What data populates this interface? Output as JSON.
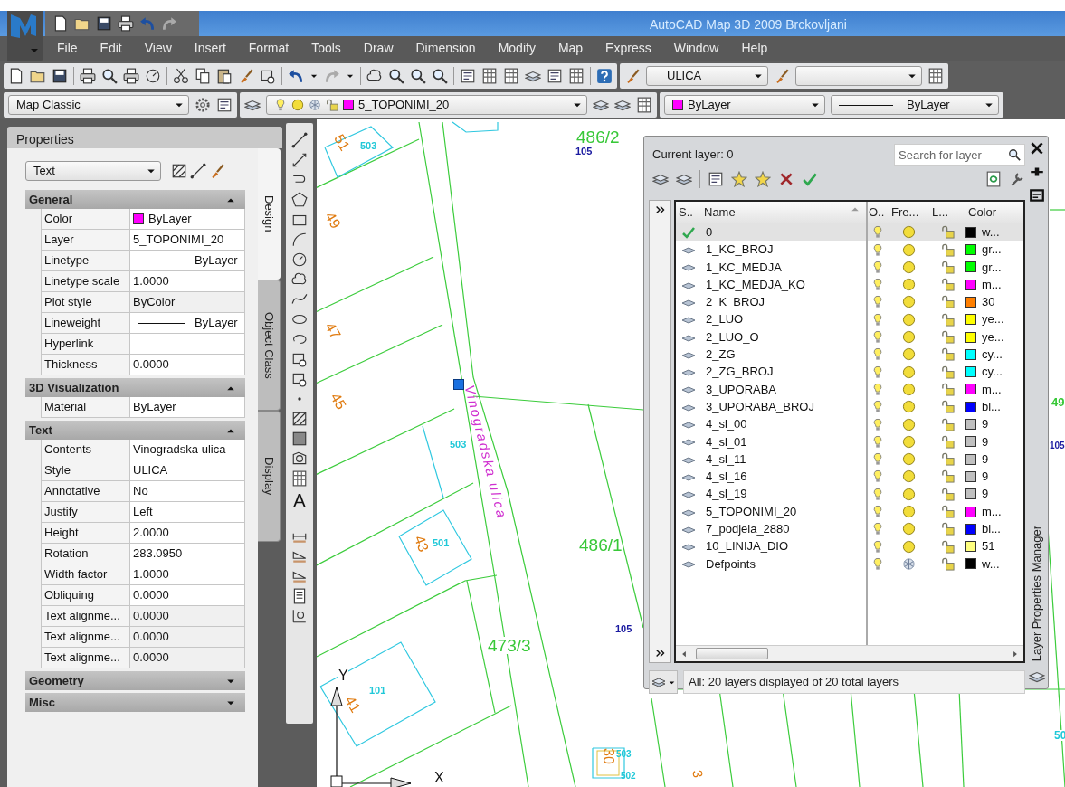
{
  "title_bar": {
    "title": "AutoCAD Map 3D 2009 Brckovljani"
  },
  "menu": [
    "File",
    "Edit",
    "View",
    "Insert",
    "Format",
    "Tools",
    "Draw",
    "Dimension",
    "Modify",
    "Map",
    "Express",
    "Window",
    "Help"
  ],
  "toolbars": {
    "text_style": "ULICA",
    "workspace": "Map Classic",
    "layer": {
      "name": "5_TOPONIMI_20",
      "color": "#ff00ff"
    },
    "color": {
      "value": "ByLayer",
      "color": "#ff00ff"
    },
    "linetype": "ByLayer"
  },
  "properties": {
    "title": "Properties",
    "object_type": "Text",
    "sections": [
      {
        "title": "General",
        "expanded": true,
        "rows": [
          {
            "label": "Color",
            "value": "ByLayer",
            "kind": "color",
            "color": "#ff00ff"
          },
          {
            "label": "Layer",
            "value": "5_TOPONIMI_20",
            "kind": "text"
          },
          {
            "label": "Linetype",
            "value": "ByLayer",
            "kind": "line"
          },
          {
            "label": "Linetype scale",
            "value": "1.0000",
            "kind": "text"
          },
          {
            "label": "Plot style",
            "value": "ByColor",
            "kind": "text",
            "disabled": true
          },
          {
            "label": "Lineweight",
            "value": "ByLayer",
            "kind": "line"
          },
          {
            "label": "Hyperlink",
            "kind": "text"
          },
          {
            "label": "Thickness",
            "value": "0.0000",
            "kind": "text"
          }
        ]
      },
      {
        "title": "3D Visualization",
        "expanded": true,
        "rows": [
          {
            "label": "Material",
            "value": "ByLayer",
            "kind": "text"
          }
        ]
      },
      {
        "title": "Text",
        "expanded": true,
        "rows": [
          {
            "label": "Contents",
            "value": "Vinogradska ulica",
            "kind": "text"
          },
          {
            "label": "Style",
            "value": "ULICA",
            "kind": "text"
          },
          {
            "label": "Annotative",
            "value": "No",
            "kind": "text"
          },
          {
            "label": "Justify",
            "value": "Left",
            "kind": "text"
          },
          {
            "label": "Height",
            "value": "2.0000",
            "kind": "text"
          },
          {
            "label": "Rotation",
            "value": "283.0950",
            "kind": "text"
          },
          {
            "label": "Width factor",
            "value": "1.0000",
            "kind": "text"
          },
          {
            "label": "Obliquing",
            "value": "0.0000",
            "kind": "text"
          },
          {
            "label": "Text alignme...",
            "value": "0.0000",
            "kind": "text",
            "disabled": true
          },
          {
            "label": "Text alignme...",
            "value": "0.0000",
            "kind": "text",
            "disabled": true
          },
          {
            "label": "Text alignme...",
            "value": "0.0000",
            "kind": "text",
            "disabled": true
          }
        ]
      },
      {
        "title": "Geometry",
        "expanded": false
      },
      {
        "title": "Misc",
        "expanded": false
      }
    ],
    "tabs": [
      {
        "label": "Design",
        "selected": true
      },
      {
        "label": "Object Class",
        "selected": false
      },
      {
        "label": "Display",
        "selected": false
      }
    ]
  },
  "draw_toolbar": {
    "text_tool": "A"
  },
  "drawing": {
    "labels": [
      {
        "text": "51",
        "color": "#e07b10"
      },
      {
        "text": "503",
        "color": "#20c8d8"
      },
      {
        "text": "486/2",
        "color": "#38c838"
      },
      {
        "text": "105",
        "color": "#1a1aa0"
      },
      {
        "text": "49",
        "color": "#e07b10"
      },
      {
        "text": "47",
        "color": "#e07b10"
      },
      {
        "text": "45",
        "color": "#e07b10"
      },
      {
        "text": "503",
        "color": "#20c8d8"
      },
      {
        "text": "43",
        "color": "#e07b10"
      },
      {
        "text": "501",
        "color": "#20c8d8"
      },
      {
        "text": "Vinogradska ulica",
        "color": "#d030d0"
      },
      {
        "text": "486/1",
        "color": "#38c838"
      },
      {
        "text": "473/3",
        "color": "#38c838"
      },
      {
        "text": "105",
        "color": "#1a1aa0"
      },
      {
        "text": "101",
        "color": "#20c8d8"
      },
      {
        "text": "41",
        "color": "#e07b10"
      },
      {
        "text": "30",
        "color": "#e07b10"
      },
      {
        "text": "503",
        "color": "#20c8d8"
      },
      {
        "text": "502",
        "color": "#20c8d8"
      },
      {
        "text": "3",
        "color": "#e07b10"
      },
      {
        "text": "49",
        "color": "#38c838"
      },
      {
        "text": "105",
        "color": "#1a1aa0"
      },
      {
        "text": "50",
        "color": "#20c8d8"
      }
    ],
    "ucs": {
      "y": "Y",
      "x": "X"
    }
  },
  "layer_manager": {
    "current_layer": "Current layer: 0",
    "search_placeholder": "Search for layer",
    "columns": [
      "S..",
      "Name",
      "O..",
      "Fre...",
      "L...",
      "Color"
    ],
    "layers": [
      {
        "name": "0",
        "current": true,
        "selected": true,
        "on": true,
        "frozen": false,
        "color": "#000000",
        "color_name": "w..."
      },
      {
        "name": "1_KC_BROJ",
        "current": false,
        "selected": false,
        "on": true,
        "frozen": false,
        "color": "#00ff00",
        "color_name": "gr..."
      },
      {
        "name": "1_KC_MEDJA",
        "current": false,
        "selected": false,
        "on": true,
        "frozen": false,
        "color": "#00ff00",
        "color_name": "gr..."
      },
      {
        "name": "1_KC_MEDJA_KO",
        "current": false,
        "selected": false,
        "on": true,
        "frozen": false,
        "color": "#ff00ff",
        "color_name": "m..."
      },
      {
        "name": "2_K_BROJ",
        "current": false,
        "selected": false,
        "on": true,
        "frozen": false,
        "color": "#ff7f00",
        "color_name": "30"
      },
      {
        "name": "2_LUO",
        "current": false,
        "selected": false,
        "on": true,
        "frozen": false,
        "color": "#ffff00",
        "color_name": "ye..."
      },
      {
        "name": "2_LUO_O",
        "current": false,
        "selected": false,
        "on": true,
        "frozen": false,
        "color": "#ffff00",
        "color_name": "ye..."
      },
      {
        "name": "2_ZG",
        "current": false,
        "selected": false,
        "on": true,
        "frozen": false,
        "color": "#00ffff",
        "color_name": "cy..."
      },
      {
        "name": "2_ZG_BROJ",
        "current": false,
        "selected": false,
        "on": true,
        "frozen": false,
        "color": "#00ffff",
        "color_name": "cy..."
      },
      {
        "name": "3_UPORABA",
        "current": false,
        "selected": false,
        "on": true,
        "frozen": false,
        "color": "#ff00ff",
        "color_name": "m..."
      },
      {
        "name": "3_UPORABA_BROJ",
        "current": false,
        "selected": false,
        "on": true,
        "frozen": false,
        "color": "#0000ff",
        "color_name": "bl..."
      },
      {
        "name": "4_sl_00",
        "current": false,
        "selected": false,
        "on": true,
        "frozen": false,
        "color": "#c0c0c0",
        "color_name": "9"
      },
      {
        "name": "4_sl_01",
        "current": false,
        "selected": false,
        "on": true,
        "frozen": false,
        "color": "#c0c0c0",
        "color_name": "9"
      },
      {
        "name": "4_sl_11",
        "current": false,
        "selected": false,
        "on": true,
        "frozen": false,
        "color": "#c0c0c0",
        "color_name": "9"
      },
      {
        "name": "4_sl_16",
        "current": false,
        "selected": false,
        "on": true,
        "frozen": false,
        "color": "#c0c0c0",
        "color_name": "9"
      },
      {
        "name": "4_sl_19",
        "current": false,
        "selected": false,
        "on": true,
        "frozen": false,
        "color": "#c0c0c0",
        "color_name": "9"
      },
      {
        "name": "5_TOPONIMI_20",
        "current": false,
        "selected": false,
        "on": true,
        "frozen": false,
        "color": "#ff00ff",
        "color_name": "m..."
      },
      {
        "name": "7_podjela_2880",
        "current": false,
        "selected": false,
        "on": true,
        "frozen": false,
        "color": "#0000ff",
        "color_name": "bl..."
      },
      {
        "name": "10_LINIJA_DIO",
        "current": false,
        "selected": false,
        "on": true,
        "frozen": false,
        "color": "#ffff7f",
        "color_name": "51"
      },
      {
        "name": "Defpoints",
        "current": false,
        "selected": false,
        "on": true,
        "frozen": true,
        "color": "#000000",
        "color_name": "w..."
      }
    ],
    "status": "All: 20 layers displayed of 20 total layers",
    "side_title": "Layer Properties Manager"
  }
}
